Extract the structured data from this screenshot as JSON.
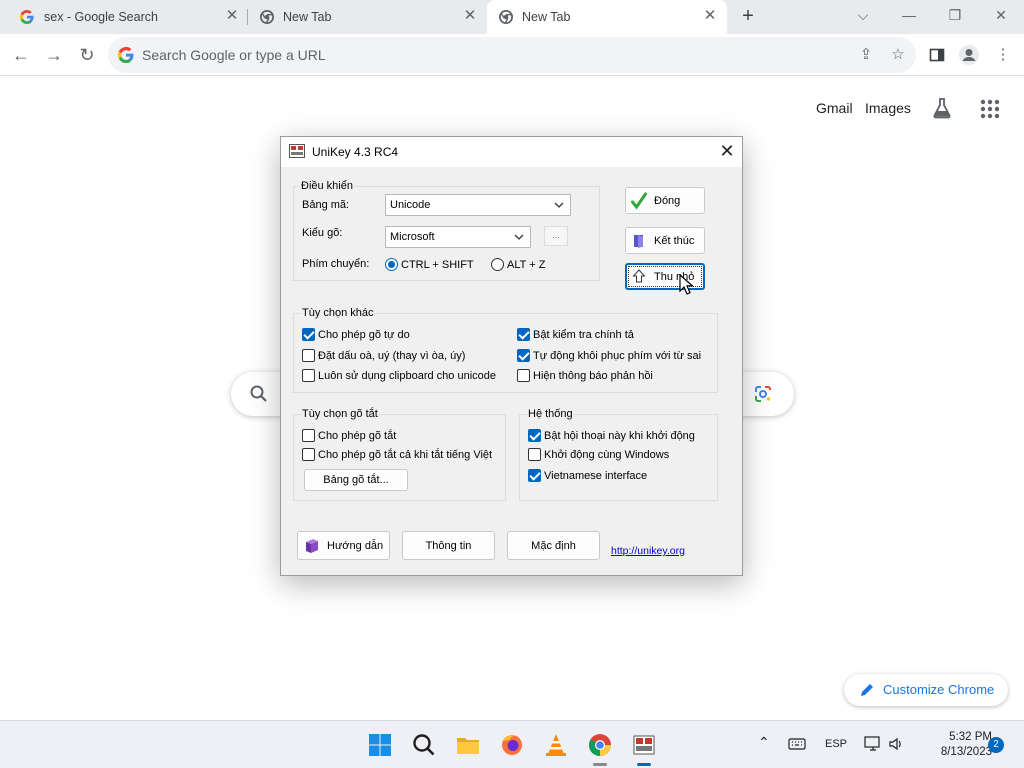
{
  "browser": {
    "tabs": [
      {
        "title": "sex - Google Search",
        "favicon": "google-g-icon",
        "active": false
      },
      {
        "title": "New Tab",
        "favicon": "chrome-icon",
        "active": false
      },
      {
        "title": "New Tab",
        "favicon": "chrome-icon",
        "active": true
      }
    ],
    "omnibox_placeholder": "Search Google or type a URL"
  },
  "ntp": {
    "gmail_label": "Gmail",
    "images_label": "Images",
    "customize_label": "Customize Chrome"
  },
  "dialog": {
    "title": "UniKey 4.3 RC4",
    "controls": {
      "group_label": "Điều khiển",
      "charset_label": "Bảng mã:",
      "charset_value": "Unicode",
      "input_label": "Kiểu gõ:",
      "input_value": "Microsoft",
      "more_label": "...",
      "switch_label": "Phím chuyển:",
      "switch_options": [
        "CTRL + SHIFT",
        "ALT + Z"
      ],
      "switch_selected": 0
    },
    "buttons": {
      "close": "Đóng",
      "exit": "Kết thúc",
      "minimize": "Thu nhỏ"
    },
    "other_options": {
      "group_label": "Tùy chọn khác",
      "items": [
        {
          "label": "Cho phép gõ tự do",
          "checked": true
        },
        {
          "label": "Bật kiểm tra chính tả",
          "checked": true
        },
        {
          "label": "Đặt dấu oà, uý (thay vì òa, úy)",
          "checked": false
        },
        {
          "label": "Tự động khôi phục phím với từ sai",
          "checked": true
        },
        {
          "label": "Luôn sử dụng clipboard cho unicode",
          "checked": false
        },
        {
          "label": "Hiện thông báo phản hồi",
          "checked": false
        }
      ]
    },
    "macro_options": {
      "group_label": "Tùy chọn gõ tắt",
      "items": [
        {
          "label": "Cho phép gõ tắt",
          "checked": false
        },
        {
          "label": "Cho phép gõ tắt cả khi tắt tiếng Việt",
          "checked": false
        }
      ],
      "table_button": "Bảng gõ tắt..."
    },
    "system": {
      "group_label": "Hệ thống",
      "items": [
        {
          "label": "Bật hội thoại này khi khởi động",
          "checked": true
        },
        {
          "label": "Khởi động cùng Windows",
          "checked": false
        },
        {
          "label": "Vietnamese interface",
          "checked": true
        }
      ]
    },
    "footer": {
      "help": "Hướng dẫn",
      "info": "Thông tin",
      "default": "Mặc định",
      "link": "http://unikey.org"
    }
  },
  "taskbar": {
    "language": "ESP",
    "time": "5:32 PM",
    "date": "8/13/2023",
    "notifications": "2"
  },
  "colors": {
    "accent": "#0067c0",
    "chrome_blue": "#1a73e8",
    "tabstrip": "#e8eaed"
  }
}
